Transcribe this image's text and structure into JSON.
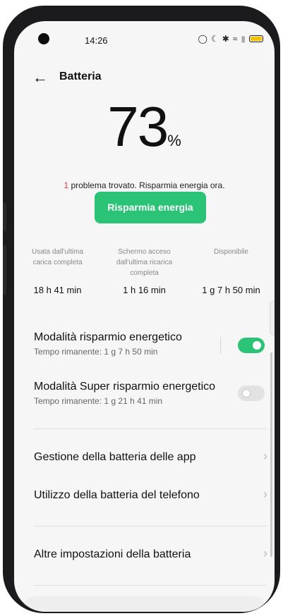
{
  "status": {
    "time": "14:26"
  },
  "header": {
    "title": "Batteria"
  },
  "battery": {
    "level": "73",
    "unit": "%"
  },
  "alert": {
    "count": "1",
    "text": " problema trovato. Risparmia energia ora."
  },
  "actions": {
    "save_label": "Risparmia energia"
  },
  "stats": [
    {
      "label": "Usata dall'ultima carica completa",
      "value": "18 h 41 min"
    },
    {
      "label": "Schermo acceso dall'ultima ricarica completa",
      "value": "1 h 16 min"
    },
    {
      "label": "Disponibile",
      "value": "1 g 7 h 50 min"
    }
  ],
  "power_saving": {
    "title": "Modalità risparmio energetico",
    "subtitle": "Tempo rimanente:  1 g 7 h 50 min",
    "enabled": true
  },
  "super_saving": {
    "title": "Modalità Super risparmio energetico",
    "subtitle": "Tempo rimanente:  1 g 21 h 41 min",
    "enabled": false
  },
  "menu": {
    "app_battery": "Gestione della batteria delle app",
    "phone_battery": "Utilizzo della batteria del telefono",
    "more_settings": "Altre impostazioni della batteria"
  },
  "colors": {
    "accent": "#2bc376",
    "alert": "#e53935"
  }
}
